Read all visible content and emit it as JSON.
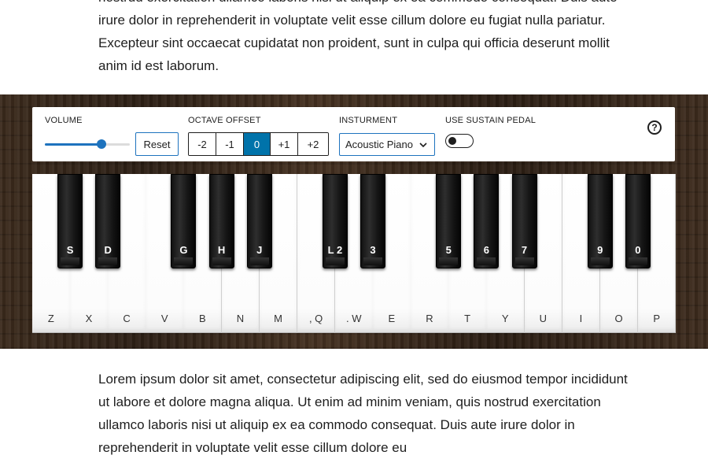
{
  "page": {
    "top_paragraph": "nostrud exercitation ullamco laboris nisi ut aliquip ex ea commodo consequat. Duis aute irure dolor in reprehenderit in voluptate velit esse cillum dolore eu fugiat nulla pariatur. Excepteur sint occaecat cupidatat non proident, sunt in culpa qui officia deserunt mollit anim id est laborum.",
    "bottom_paragraph": "Lorem ipsum dolor sit amet, consectetur adipiscing elit, sed do eiusmod tempor incididunt ut labore et dolore magna aliqua. Ut enim ad minim veniam, quis nostrud exercitation ullamco laboris nisi ut aliquip ex ea commodo consequat. Duis aute irure dolor in reprehenderit in voluptate velit esse cillum dolore eu"
  },
  "controls": {
    "volume_label": "VOLUME",
    "volume_level": 0.67,
    "reset_label": "Reset",
    "octave_label": "OCTAVE OFFSET",
    "octave_options": [
      "-2",
      "-1",
      "0",
      "+1",
      "+2"
    ],
    "octave_selected": "0",
    "instrument_label": "INSTURMENT",
    "instrument_value": "Acoustic Piano",
    "sustain_label": "USE SUSTAIN PEDAL",
    "sustain_on": false,
    "help_icon": "help-circle-icon",
    "help_glyph": "?"
  },
  "keyboard": {
    "white_keys": [
      "Z",
      "X",
      "C",
      "V",
      "B",
      "N",
      "M",
      ", Q",
      ". W",
      "E",
      "R",
      "T",
      "Y",
      "U",
      "I",
      "O",
      "P"
    ],
    "black_keys": [
      {
        "after_white": 1,
        "label": "S"
      },
      {
        "after_white": 2,
        "label": "D"
      },
      {
        "after_white": 4,
        "label": "G"
      },
      {
        "after_white": 5,
        "label": "H"
      },
      {
        "after_white": 6,
        "label": "J"
      },
      {
        "after_white": 8,
        "label": "L 2"
      },
      {
        "after_white": 9,
        "label": "3"
      },
      {
        "after_white": 11,
        "label": "5"
      },
      {
        "after_white": 12,
        "label": "6"
      },
      {
        "after_white": 13,
        "label": "7"
      },
      {
        "after_white": 15,
        "label": "9"
      },
      {
        "after_white": 16,
        "label": "0"
      }
    ]
  },
  "colors": {
    "accent": "#0073aa",
    "control_border": "#1e73be",
    "wood": "#3b2a1c"
  }
}
